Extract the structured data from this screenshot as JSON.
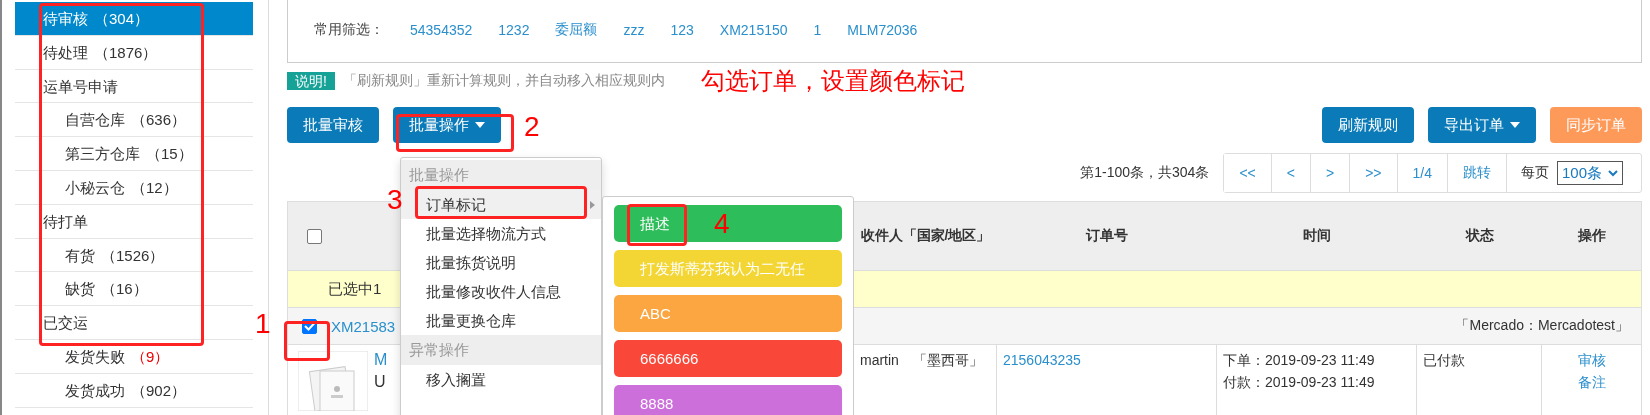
{
  "sidebar": {
    "items": [
      {
        "label": "待审核",
        "count": "（304）",
        "selected": true,
        "count_alert": false
      },
      {
        "label": "待处理",
        "count": "（1876）",
        "selected": false,
        "count_alert": false
      },
      {
        "label": "运单号申请",
        "selected": false,
        "children": [
          {
            "label": "自营仓库",
            "count": "（636）",
            "selected": false,
            "count_alert": false
          },
          {
            "label": "第三方仓库",
            "count": "（15）",
            "selected": false,
            "count_alert": false
          },
          {
            "label": "小秘云仓",
            "count": "（12）",
            "selected": false,
            "count_alert": false
          }
        ]
      },
      {
        "label": "待打单",
        "selected": false,
        "children": [
          {
            "label": "有货",
            "count": "（1526）",
            "selected": false,
            "count_alert": false
          },
          {
            "label": "缺货",
            "count": "（16）",
            "selected": false,
            "count_alert": false
          }
        ]
      },
      {
        "label": "已交运",
        "selected": false,
        "children": [
          {
            "label": "发货失败",
            "count": "（9）",
            "selected": false,
            "count_alert": true
          },
          {
            "label": "发货成功",
            "count": "（902）",
            "selected": false,
            "count_alert": false
          }
        ]
      }
    ]
  },
  "filters": {
    "label": "常用筛选：",
    "links": [
      "54354352",
      "1232",
      "委屈额",
      "zzz",
      "123",
      "XM215150",
      "1",
      "MLM72036"
    ]
  },
  "notice": {
    "badge": "说明!",
    "text": "「刷新规则」重新计算规则，并自动移入相应规则内"
  },
  "toolbar": {
    "left": [
      {
        "label": "批量审核",
        "dropdown": false
      },
      {
        "label": "批量操作",
        "dropdown": true
      }
    ],
    "right": [
      {
        "label": "刷新规则",
        "dropdown": false,
        "kind": "primary"
      },
      {
        "label": "导出订单",
        "dropdown": true,
        "kind": "primary"
      },
      {
        "label": "同步订单",
        "dropdown": false,
        "kind": "warning"
      }
    ]
  },
  "pagination": {
    "summary": "第1-100条，共304条",
    "buttons": [
      "<<",
      "<",
      ">",
      ">>",
      "1/4",
      "跳转"
    ],
    "per_page_label": "每页",
    "per_page": "100条"
  },
  "table": {
    "header_checked": false,
    "columns": [
      "收件人「国家/地区」",
      "订单号",
      "时间",
      "状态",
      "操作"
    ],
    "selection_notice": "已选中1",
    "order": {
      "checked": true,
      "number": "XM21583",
      "store": "「Mercado：Mercadotest」",
      "product_line_1": "M",
      "product_line_2": "U",
      "recipient": "martin　「墨西哥」",
      "order_no": "2156043235",
      "times": [
        "下单：2019-09-23 11:49",
        "付款：2019-09-23 11:49"
      ],
      "status": "已付款",
      "actions": [
        "审核",
        "备注"
      ]
    }
  },
  "dropdown_menu": {
    "items": [
      {
        "kind": "header",
        "label": "批量操作"
      },
      {
        "kind": "item",
        "label": "订单标记",
        "selected": true,
        "submenu": true
      },
      {
        "kind": "item",
        "label": "批量选择物流方式",
        "selected": false,
        "submenu": false
      },
      {
        "kind": "item",
        "label": "批量拣货说明",
        "selected": false,
        "submenu": false
      },
      {
        "kind": "item",
        "label": "批量修改收件人信息",
        "selected": false,
        "submenu": false
      },
      {
        "kind": "item",
        "label": "批量更换仓库",
        "selected": false,
        "submenu": false
      },
      {
        "kind": "header",
        "label": "异常操作"
      },
      {
        "kind": "item",
        "label": "移入搁置",
        "selected": false,
        "submenu": false
      }
    ]
  },
  "color_tags": [
    {
      "label": "描述",
      "color": "#2dbd5a"
    },
    {
      "label": "打发斯蒂芬我认为二无任",
      "color": "#f3d634"
    },
    {
      "label": "ABC",
      "color": "#fba640"
    },
    {
      "label": "6666666",
      "color": "#f9483a"
    },
    {
      "label": "8888",
      "color": "#cc6fdb"
    }
  ],
  "annotations": {
    "caption": "勾选订单，设置颜色标记",
    "steps": [
      "1",
      "2",
      "3",
      "4"
    ]
  }
}
